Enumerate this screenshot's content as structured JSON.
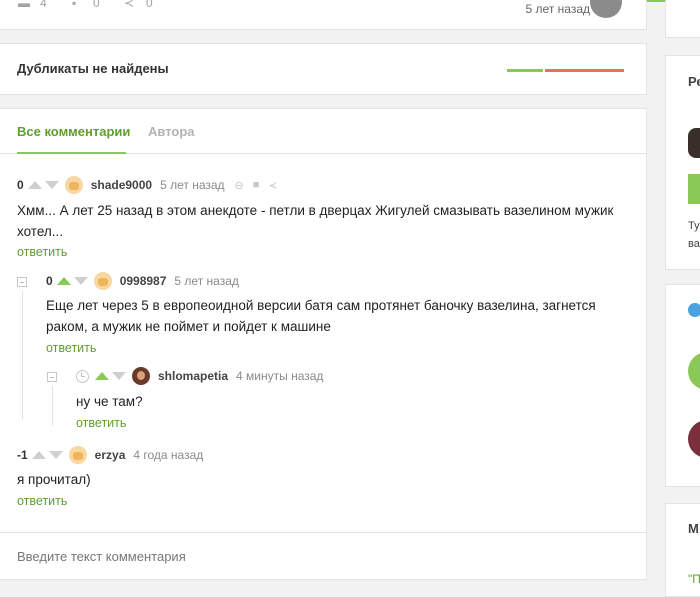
{
  "post_stats": {
    "comments": "4",
    "saves": "0",
    "shares": "0",
    "time": "5 лет назад"
  },
  "duplicates": {
    "title": "Дубликаты не найдены"
  },
  "tabs": {
    "all": "Все комментарии",
    "author": "Автора"
  },
  "comments": [
    {
      "rating": "0",
      "user": "shade9000",
      "time": "5 лет назад",
      "text": "Хмм... А лет 25 назад в этом анекдоте - петли в дверцах Жигулей смазывать вазелином мужик хотел...",
      "reply": "ответить"
    },
    {
      "rating": "0",
      "user": "0998987",
      "time": "5 лет назад",
      "text": "Еще лет через 5 в европеоидной версии батя сам протянет баночку вазелина, загнется раком, а мужик не поймет и пойдет к машине",
      "reply": "ответить"
    },
    {
      "rating": "",
      "user": "shlomapetia",
      "time": "4 минуты назад",
      "text": "ну че там?",
      "reply": "ответить"
    },
    {
      "rating": "-1",
      "user": "erzya",
      "time": "4 года назад",
      "text": "я прочитал)",
      "reply": "ответить"
    }
  ],
  "comment_input": {
    "placeholder": "Введите текст комментария"
  },
  "sidebar": {
    "block1_label": "Ре",
    "block1_line1": "Ту",
    "block1_line2": "ва",
    "block3_label": "М",
    "block3_text": "\"П"
  },
  "colors": {
    "accent": "#8ac858",
    "link": "#5f9e2f",
    "negative": "#e86f5c"
  },
  "icons": [
    "comment-icon",
    "save-icon",
    "share-icon",
    "link-icon",
    "clock-icon",
    "telegram-icon"
  ]
}
